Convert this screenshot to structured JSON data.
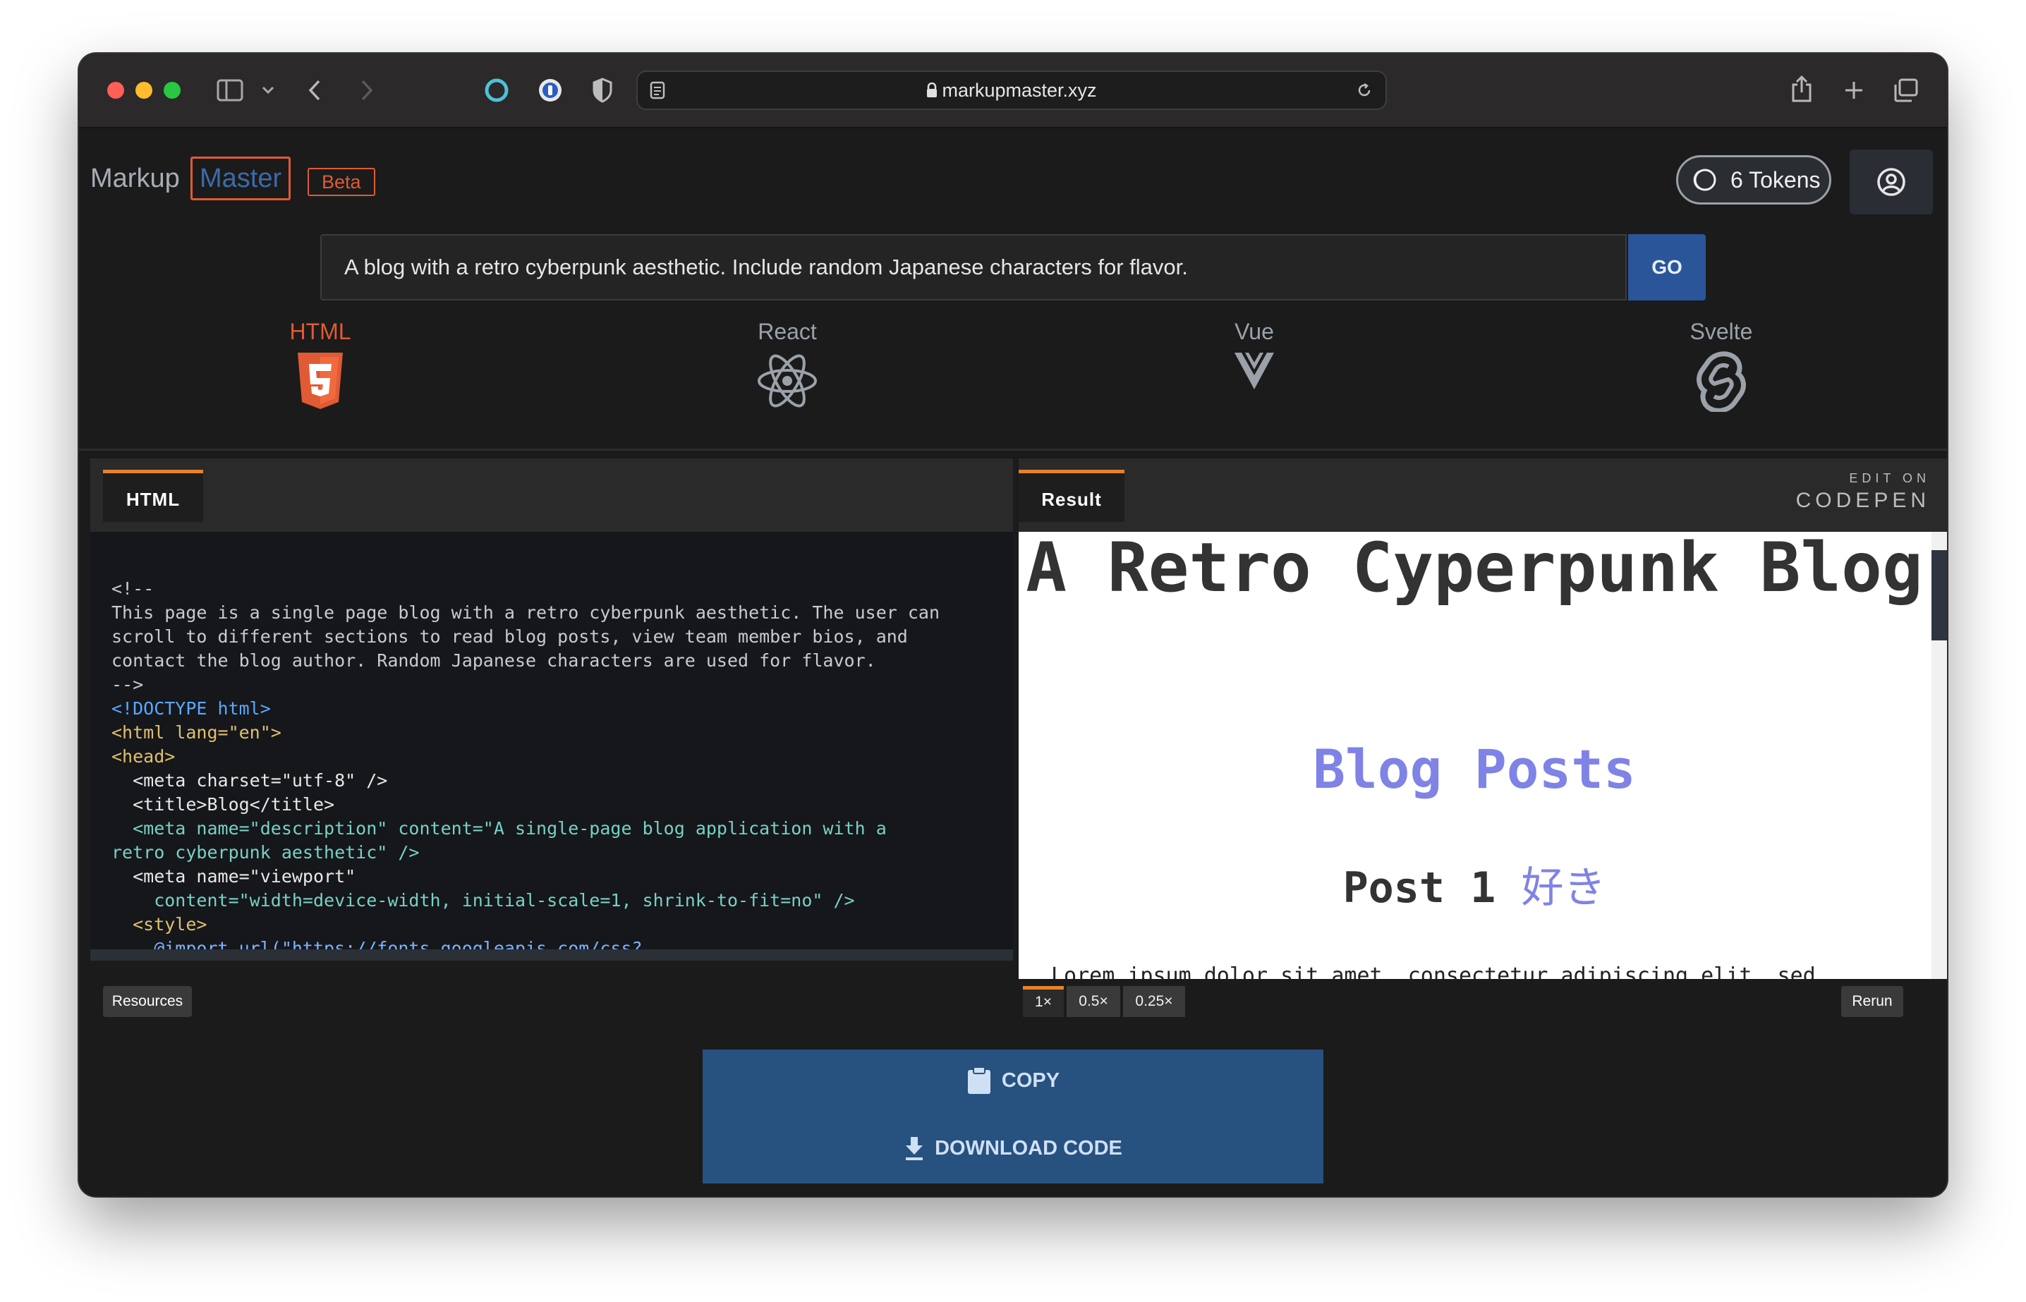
{
  "browser": {
    "url": "markupmaster.xyz"
  },
  "header": {
    "brand_first": "Markup",
    "brand_second": "Master",
    "badge": "Beta",
    "tokens": "6 Tokens"
  },
  "prompt": {
    "value": "A blog with a retro cyberpunk aesthetic. Include random Japanese characters for flavor.",
    "go_label": "GO"
  },
  "frameworks": [
    {
      "label": "HTML",
      "icon": "html5-icon",
      "color": "#e05a33",
      "active": true
    },
    {
      "label": "React",
      "icon": "react-icon",
      "color": "#9aa1a9",
      "active": false
    },
    {
      "label": "Vue",
      "icon": "vue-icon",
      "color": "#9aa1a9",
      "active": false
    },
    {
      "label": "Svelte",
      "icon": "svelte-icon",
      "color": "#9aa1a9",
      "active": false
    }
  ],
  "codepen": {
    "html_tab": "HTML",
    "result_tab": "Result",
    "edit_on": "EDIT ON",
    "codepen_logo": "CODEPEN",
    "code_lines": [
      "<!--",
      "This page is a single page blog with a retro cyberpunk aesthetic. The user can",
      "scroll to different sections to read blog posts, view team member bios, and",
      "contact the blog author. Random Japanese characters are used for flavor.",
      "-->",
      "<!DOCTYPE html>",
      "<html lang=\"en\">",
      "<head>",
      "  <meta charset=\"utf-8\" />",
      "  <title>Blog</title>",
      "  <meta name=\"description\" content=\"A single-page blog application with a",
      "retro cyberpunk aesthetic\" />",
      "  <meta name=\"viewport\"",
      "    content=\"width=device-width, initial-scale=1, shrink-to-fit=no\" />",
      "  <style>",
      "    @import url(\"https://fonts.googleapis.com/css?"
    ],
    "result": {
      "heading": "A Retro Cyperpunk Blog",
      "section_title": "Blog Posts",
      "post_title": "Post 1",
      "post_title_jp": "好き",
      "paragraph": "Lorem ipsum dolor sit amet, consectetur adipiscing elit, sed"
    },
    "resources_label": "Resources",
    "zoom_options": [
      "1×",
      "0.5×",
      "0.25×"
    ],
    "zoom_selected": "1×",
    "rerun_label": "Rerun"
  },
  "actions": {
    "copy_label": "COPY",
    "download_label": "DOWNLOAD CODE"
  },
  "colors": {
    "accent_orange": "#e05a33",
    "primary_blue": "#2a5699",
    "action_blue": "#27517f",
    "result_purple": "#7f83e6"
  }
}
